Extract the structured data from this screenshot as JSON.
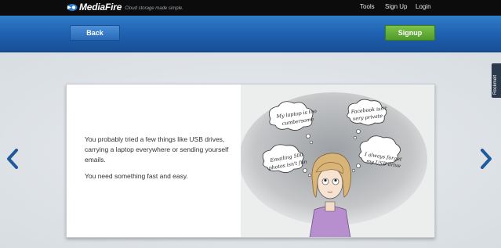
{
  "header": {
    "logo_text": "MediaFire",
    "tagline": "Cloud storage made simple.",
    "nav": {
      "tools": "Tools",
      "signup": "Sign Up",
      "login": "Login"
    }
  },
  "band": {
    "back_label": "Back",
    "signup_label": "Signup"
  },
  "slide": {
    "paragraph1": "You probably tried a few things like USB drives, carrying a laptop everywhere or sending yourself emails.",
    "paragraph2": "You need something fast and easy.",
    "bubbles": {
      "laptop": [
        "My laptop is too",
        "cumbersome"
      ],
      "facebook": [
        "Facebook isn't",
        "very private"
      ],
      "emailing": [
        "Emailing 500",
        "photos isn't fun"
      ],
      "usb": [
        "I always forget",
        "my USB drive"
      ]
    }
  },
  "rockmelt_label": "Rockmelt",
  "colors": {
    "band_blue": "#1e5fae",
    "signup_green": "#5aab33",
    "arrow_blue": "#1f5b9c"
  },
  "icons": {
    "prev": "chevron-left-icon",
    "next": "chevron-right-icon",
    "logo": "mediafire-logo-icon"
  }
}
